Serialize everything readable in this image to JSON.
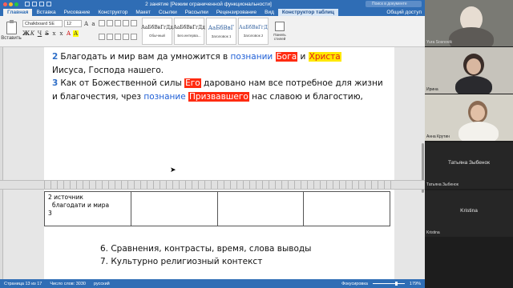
{
  "window": {
    "title": "2 занятие [Режим ограниченной функциональности]",
    "search_placeholder": "Поиск в документе"
  },
  "ribbon_tabs": [
    "Главная",
    "Вставка",
    "Рисование",
    "Конструктор",
    "Макет",
    "Ссылки",
    "Рассылки",
    "Рецензирование",
    "Вид",
    "Конструктор таблиц"
  ],
  "share_label": "Общий доступ",
  "ribbon": {
    "paste_label": "Вставить",
    "font_name": "Chalkboard SE",
    "font_size": "12",
    "styles": [
      {
        "sample": "АаБбВвГгДд",
        "label": "Обычный"
      },
      {
        "sample": "АаБбВвГгДд",
        "label": "Без интерва..."
      },
      {
        "sample": "АаБбВвГ",
        "label": "Заголовок 1"
      },
      {
        "sample": "АаБбВвГгД",
        "label": "Заголовок 2"
      }
    ],
    "styles_pane_label": "Панель стилей"
  },
  "document": {
    "verse2": {
      "num": "2",
      "t1": "Благодать и мир вам да умножится в ",
      "k1": "познании",
      "s1": " ",
      "k2": "Бога",
      "s2": " и ",
      "k3": "Христа",
      "t2": "Иисуса, Господа нашего."
    },
    "verse3": {
      "num": "3",
      "t1": "Как от Божественной силы ",
      "k1": "Его",
      "t2": " даровано нам все потребное для жизни и благочестия, чрез ",
      "k2": "познание",
      "s1": " ",
      "k3": "Призвавшего",
      "t3": " нас славою и благостию,"
    },
    "table_cell_1": "2 источник",
    "table_cell_2": "благодати и мира",
    "table_cell_3": "3",
    "list_items": [
      "6. Сравнения, контрасты, время, слова выводы",
      "7. Культурно религиозный контекст"
    ]
  },
  "status_bar": {
    "page": "Страница 13 из 17",
    "words": "Число слов: 3030",
    "lang": "русский",
    "focus": "Фокусировка",
    "zoom": "179%"
  },
  "participants": [
    {
      "name": "Yura Sosnovik"
    },
    {
      "name": "Ирина"
    },
    {
      "name": "Анна Крутин"
    },
    {
      "name": "Татьяна Зыбенок",
      "big": "Татьяна Зыбенок"
    },
    {
      "name": "Kristina",
      "big": "Kristina"
    }
  ],
  "colors": {
    "accent": "#2f6db5",
    "verse_number": "#2f6fc8",
    "keyword": "#1f5fd6",
    "highlight_red": "#ff2b10",
    "highlight_yellow": "#ffe800"
  }
}
